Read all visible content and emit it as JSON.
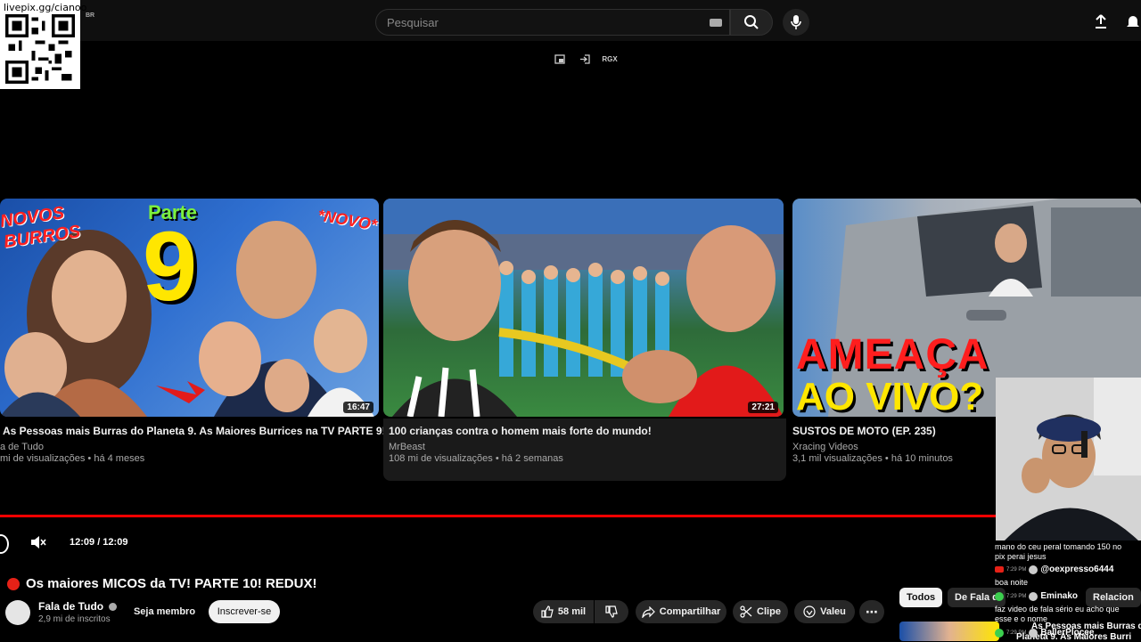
{
  "overlay": {
    "qr_url": "livepix.gg/cianoo"
  },
  "header": {
    "country": "BR",
    "search_placeholder": "Pesquisar"
  },
  "mini_player": {
    "rgx_label": "RGX"
  },
  "videos": [
    {
      "title": "As Pessoas mais Burras do Planeta 9. As Maiores Burrices na TV PARTE 9!",
      "channel": "a de Tudo",
      "meta": "mi de visualizações • há 4 meses",
      "duration": "16:47",
      "thumb_text": {
        "novos": "NOVOS",
        "burros": "BURROS",
        "parte": "Parte",
        "num": "9",
        "novo": "*NOVO*"
      }
    },
    {
      "title": "100 crianças contra o homem mais forte do mundo!",
      "channel": "MrBeast",
      "meta": "108 mi de visualizações • há 2 semanas",
      "duration": "27:21"
    },
    {
      "title": "SUSTOS DE MOTO (EP. 235)",
      "channel": "Xracing Videos",
      "meta": "3,1 mil visualizações • há 10 minutos",
      "thumb_text": {
        "line1": "AMEAÇA",
        "line2": "AO VIVO?"
      }
    }
  ],
  "player": {
    "time": "12:09 / 12:09",
    "progress": 1.0
  },
  "watch": {
    "title": "Os maiores MICOS da TV! PARTE 10! REDUX!",
    "channel": "Fala de Tudo",
    "subscribers": "2,9 mi de inscritos",
    "member_btn": "Seja membro",
    "subscribe_btn": "Inscrever-se",
    "likes": "58 mil",
    "share": "Compartilhar",
    "clip": "Clipe",
    "thanks": "Valeu"
  },
  "chat": {
    "messages": [
      {
        "text": "mano do ceu peral tomando 150 no"
      },
      {
        "text": "pix perai jesus"
      },
      {
        "time": "7:29 PM",
        "user": "@oexpresso6444"
      },
      {
        "text": "boa noite"
      },
      {
        "time": "7:29 PM",
        "user": "Eminako"
      },
      {
        "text": "faz video de fala sério eu acho que"
      },
      {
        "text": "esse e o nome"
      },
      {
        "time": "7:29 PM",
        "user": "BallerPlocee"
      }
    ]
  },
  "related": {
    "tabs": [
      "Todos",
      "De Fala d",
      "Relacion"
    ],
    "preview_title_1": "As Pessoas mais Burras d",
    "preview_title_2": "Planeta 9. As Maiores Burri"
  },
  "colors": {
    "accent": "#ff0000",
    "live": "#e62117",
    "background": "#000000"
  }
}
